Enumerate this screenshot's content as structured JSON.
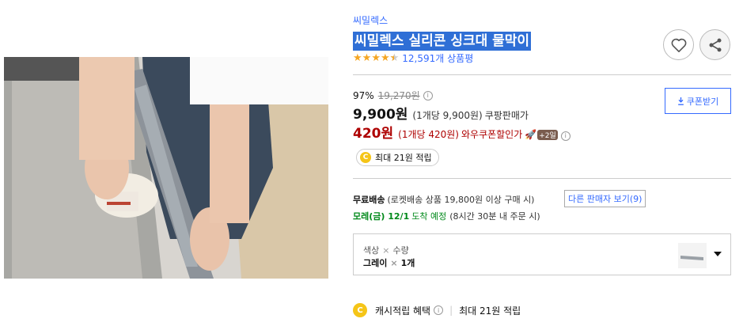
{
  "product": {
    "brand": "씨밀렉스",
    "title": "씨밀렉스 실리콘 싱크대 물막이",
    "rating": 4.5,
    "review_count": "12,591개 상품평"
  },
  "pricing": {
    "discount": "97%",
    "original_price": "19,270원",
    "price": "9,900원",
    "price_per_unit": "(1개당 9,900원)",
    "seller_label": "쿠팡판매가",
    "coupon_price": "420원",
    "coupon_per_unit": "(1개당 420원)",
    "coupon_label": "와우쿠폰할인가",
    "coupon_plus_badge": "+2일",
    "coupon_button": "쿠폰받기",
    "cash_pill": "최대 21원 적립"
  },
  "shipping": {
    "free_label": "무료배송",
    "free_detail": "(로켓배송 상품 19,800원 이상 구매 시)",
    "other_seller": "다른 판매자 보기(9)",
    "delivery_date": "모레(금) 12/1",
    "delivery_expect": "도착 예정",
    "delivery_cutoff": "(8시간 30분 내 주문 시)"
  },
  "option": {
    "name_color": "색상",
    "name_qty": "수량",
    "value_color": "그레이",
    "value_qty": "1개",
    "sep": "×"
  },
  "cash": {
    "label": "캐시적립 혜택",
    "amount": "최대 21원 적립"
  },
  "icons": {
    "coin_letter": "C",
    "info": "i"
  },
  "colors": {
    "link": "#346aff",
    "coupon": "#ae0000",
    "delivery": "#00891a",
    "star": "#f5a623"
  }
}
